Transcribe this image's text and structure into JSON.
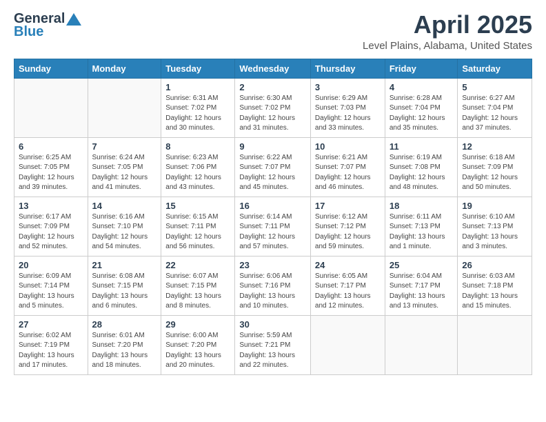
{
  "logo": {
    "general": "General",
    "blue": "Blue"
  },
  "title": {
    "month": "April 2025",
    "location": "Level Plains, Alabama, United States"
  },
  "headers": [
    "Sunday",
    "Monday",
    "Tuesday",
    "Wednesday",
    "Thursday",
    "Friday",
    "Saturday"
  ],
  "weeks": [
    [
      {
        "day": "",
        "info": ""
      },
      {
        "day": "",
        "info": ""
      },
      {
        "day": "1",
        "info": "Sunrise: 6:31 AM\nSunset: 7:02 PM\nDaylight: 12 hours\nand 30 minutes."
      },
      {
        "day": "2",
        "info": "Sunrise: 6:30 AM\nSunset: 7:02 PM\nDaylight: 12 hours\nand 31 minutes."
      },
      {
        "day": "3",
        "info": "Sunrise: 6:29 AM\nSunset: 7:03 PM\nDaylight: 12 hours\nand 33 minutes."
      },
      {
        "day": "4",
        "info": "Sunrise: 6:28 AM\nSunset: 7:04 PM\nDaylight: 12 hours\nand 35 minutes."
      },
      {
        "day": "5",
        "info": "Sunrise: 6:27 AM\nSunset: 7:04 PM\nDaylight: 12 hours\nand 37 minutes."
      }
    ],
    [
      {
        "day": "6",
        "info": "Sunrise: 6:25 AM\nSunset: 7:05 PM\nDaylight: 12 hours\nand 39 minutes."
      },
      {
        "day": "7",
        "info": "Sunrise: 6:24 AM\nSunset: 7:05 PM\nDaylight: 12 hours\nand 41 minutes."
      },
      {
        "day": "8",
        "info": "Sunrise: 6:23 AM\nSunset: 7:06 PM\nDaylight: 12 hours\nand 43 minutes."
      },
      {
        "day": "9",
        "info": "Sunrise: 6:22 AM\nSunset: 7:07 PM\nDaylight: 12 hours\nand 45 minutes."
      },
      {
        "day": "10",
        "info": "Sunrise: 6:21 AM\nSunset: 7:07 PM\nDaylight: 12 hours\nand 46 minutes."
      },
      {
        "day": "11",
        "info": "Sunrise: 6:19 AM\nSunset: 7:08 PM\nDaylight: 12 hours\nand 48 minutes."
      },
      {
        "day": "12",
        "info": "Sunrise: 6:18 AM\nSunset: 7:09 PM\nDaylight: 12 hours\nand 50 minutes."
      }
    ],
    [
      {
        "day": "13",
        "info": "Sunrise: 6:17 AM\nSunset: 7:09 PM\nDaylight: 12 hours\nand 52 minutes."
      },
      {
        "day": "14",
        "info": "Sunrise: 6:16 AM\nSunset: 7:10 PM\nDaylight: 12 hours\nand 54 minutes."
      },
      {
        "day": "15",
        "info": "Sunrise: 6:15 AM\nSunset: 7:11 PM\nDaylight: 12 hours\nand 56 minutes."
      },
      {
        "day": "16",
        "info": "Sunrise: 6:14 AM\nSunset: 7:11 PM\nDaylight: 12 hours\nand 57 minutes."
      },
      {
        "day": "17",
        "info": "Sunrise: 6:12 AM\nSunset: 7:12 PM\nDaylight: 12 hours\nand 59 minutes."
      },
      {
        "day": "18",
        "info": "Sunrise: 6:11 AM\nSunset: 7:13 PM\nDaylight: 13 hours\nand 1 minute."
      },
      {
        "day": "19",
        "info": "Sunrise: 6:10 AM\nSunset: 7:13 PM\nDaylight: 13 hours\nand 3 minutes."
      }
    ],
    [
      {
        "day": "20",
        "info": "Sunrise: 6:09 AM\nSunset: 7:14 PM\nDaylight: 13 hours\nand 5 minutes."
      },
      {
        "day": "21",
        "info": "Sunrise: 6:08 AM\nSunset: 7:15 PM\nDaylight: 13 hours\nand 6 minutes."
      },
      {
        "day": "22",
        "info": "Sunrise: 6:07 AM\nSunset: 7:15 PM\nDaylight: 13 hours\nand 8 minutes."
      },
      {
        "day": "23",
        "info": "Sunrise: 6:06 AM\nSunset: 7:16 PM\nDaylight: 13 hours\nand 10 minutes."
      },
      {
        "day": "24",
        "info": "Sunrise: 6:05 AM\nSunset: 7:17 PM\nDaylight: 13 hours\nand 12 minutes."
      },
      {
        "day": "25",
        "info": "Sunrise: 6:04 AM\nSunset: 7:17 PM\nDaylight: 13 hours\nand 13 minutes."
      },
      {
        "day": "26",
        "info": "Sunrise: 6:03 AM\nSunset: 7:18 PM\nDaylight: 13 hours\nand 15 minutes."
      }
    ],
    [
      {
        "day": "27",
        "info": "Sunrise: 6:02 AM\nSunset: 7:19 PM\nDaylight: 13 hours\nand 17 minutes."
      },
      {
        "day": "28",
        "info": "Sunrise: 6:01 AM\nSunset: 7:20 PM\nDaylight: 13 hours\nand 18 minutes."
      },
      {
        "day": "29",
        "info": "Sunrise: 6:00 AM\nSunset: 7:20 PM\nDaylight: 13 hours\nand 20 minutes."
      },
      {
        "day": "30",
        "info": "Sunrise: 5:59 AM\nSunset: 7:21 PM\nDaylight: 13 hours\nand 22 minutes."
      },
      {
        "day": "",
        "info": ""
      },
      {
        "day": "",
        "info": ""
      },
      {
        "day": "",
        "info": ""
      }
    ]
  ]
}
